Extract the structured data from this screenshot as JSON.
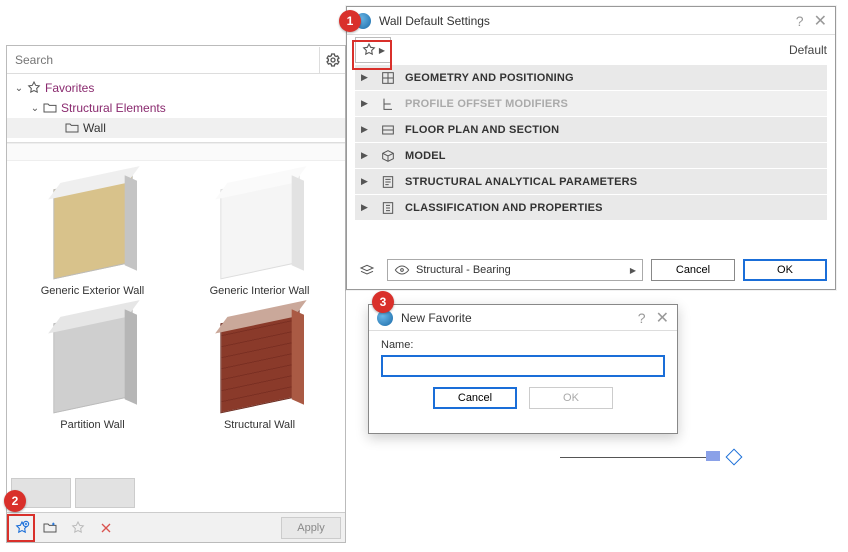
{
  "left": {
    "search_placeholder": "Search",
    "tree": {
      "root": "Favorites",
      "child": "Structural Elements",
      "leaf": "Wall"
    },
    "thumbs": [
      {
        "label": "Generic Exterior Wall",
        "cls": "w-ext"
      },
      {
        "label": "Generic Interior Wall",
        "cls": "w-int"
      },
      {
        "label": "Partition Wall",
        "cls": "w-par"
      },
      {
        "label": "Structural Wall",
        "cls": "w-str"
      }
    ],
    "apply": "Apply",
    "icons": {
      "add_fav": "add-favorite-icon",
      "folder": "new-folder-icon",
      "star": "star-icon",
      "del": "delete-icon",
      "gear": "gear-icon"
    }
  },
  "dialog": {
    "title": "Wall Default Settings",
    "default": "Default",
    "sections": [
      {
        "label": "GEOMETRY AND POSITIONING",
        "disabled": false
      },
      {
        "label": "PROFILE OFFSET MODIFIERS",
        "disabled": true
      },
      {
        "label": "FLOOR PLAN AND SECTION",
        "disabled": false
      },
      {
        "label": "MODEL",
        "disabled": false
      },
      {
        "label": "STRUCTURAL ANALYTICAL PARAMETERS",
        "disabled": false
      },
      {
        "label": "CLASSIFICATION AND PROPERTIES",
        "disabled": false
      }
    ],
    "layer": "Structural - Bearing",
    "cancel": "Cancel",
    "ok": "OK"
  },
  "modal": {
    "title": "New Favorite",
    "name_label": "Name:",
    "name_value": "",
    "cancel": "Cancel",
    "ok": "OK"
  },
  "annotations": {
    "a1": "1",
    "a2": "2",
    "a3": "3"
  }
}
